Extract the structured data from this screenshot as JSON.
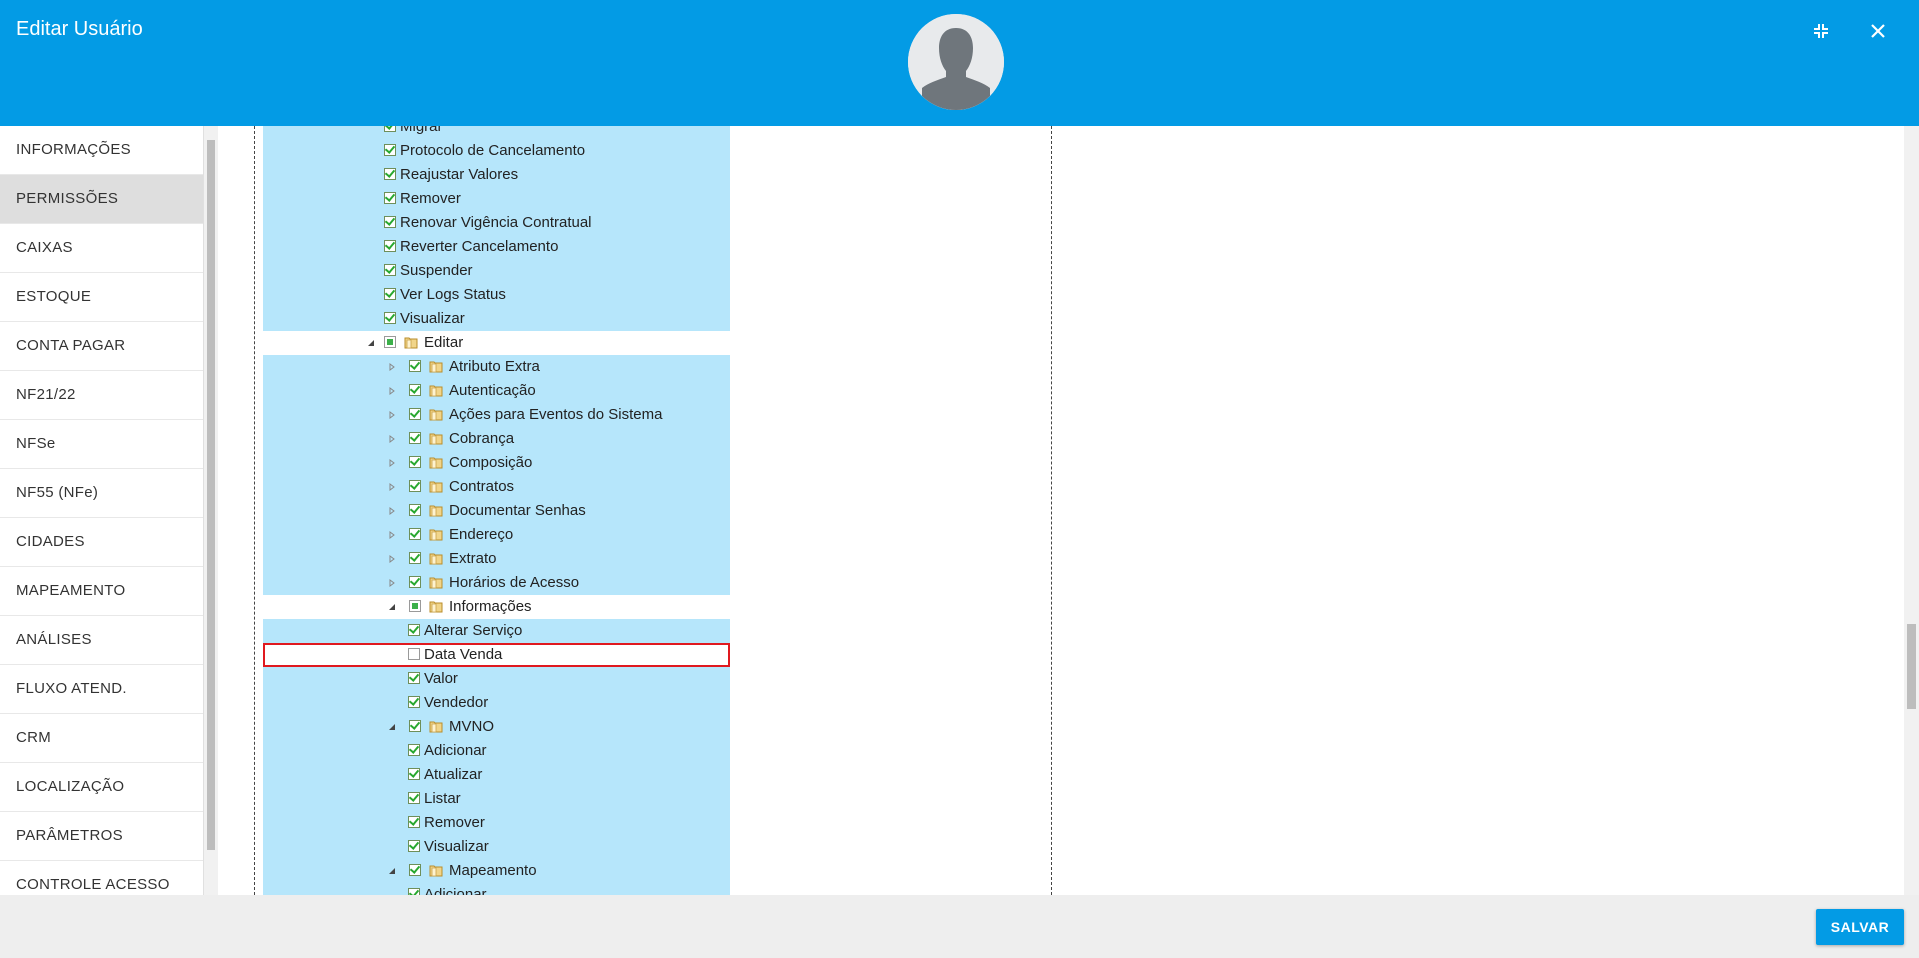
{
  "header": {
    "title": "Editar Usuário"
  },
  "sidebar": {
    "items": [
      {
        "label": "INFORMAÇÕES",
        "active": false
      },
      {
        "label": "PERMISSÕES",
        "active": true
      },
      {
        "label": "CAIXAS",
        "active": false
      },
      {
        "label": "ESTOQUE",
        "active": false
      },
      {
        "label": "CONTA PAGAR",
        "active": false
      },
      {
        "label": "NF21/22",
        "active": false
      },
      {
        "label": "NFSe",
        "active": false
      },
      {
        "label": "NF55 (NFe)",
        "active": false
      },
      {
        "label": "CIDADES",
        "active": false
      },
      {
        "label": "MAPEAMENTO",
        "active": false
      },
      {
        "label": "ANÁLISES",
        "active": false
      },
      {
        "label": "FLUXO ATEND.",
        "active": false
      },
      {
        "label": "CRM",
        "active": false
      },
      {
        "label": "LOCALIZAÇÃO",
        "active": false
      },
      {
        "label": "PARÂMETROS",
        "active": false
      },
      {
        "label": "CONTROLE ACESSO",
        "active": false
      }
    ]
  },
  "tree": {
    "rows": [
      {
        "label": "Migrar",
        "level": 0,
        "state": "checked",
        "folder": false,
        "expander": "none",
        "selected": true
      },
      {
        "label": "Protocolo de Cancelamento",
        "level": 0,
        "state": "checked",
        "folder": false,
        "expander": "none",
        "selected": true
      },
      {
        "label": "Reajustar Valores",
        "level": 0,
        "state": "checked",
        "folder": false,
        "expander": "none",
        "selected": true
      },
      {
        "label": "Remover",
        "level": 0,
        "state": "checked",
        "folder": false,
        "expander": "none",
        "selected": true
      },
      {
        "label": "Renovar Vigência Contratual",
        "level": 0,
        "state": "checked",
        "folder": false,
        "expander": "none",
        "selected": true
      },
      {
        "label": "Reverter Cancelamento",
        "level": 0,
        "state": "checked",
        "folder": false,
        "expander": "none",
        "selected": true
      },
      {
        "label": "Suspender",
        "level": 0,
        "state": "checked",
        "folder": false,
        "expander": "none",
        "selected": true
      },
      {
        "label": "Ver Logs Status",
        "level": 0,
        "state": "checked",
        "folder": false,
        "expander": "none",
        "selected": true
      },
      {
        "label": "Visualizar",
        "level": 0,
        "state": "checked",
        "folder": false,
        "expander": "none",
        "selected": true
      },
      {
        "label": "Editar",
        "level": 0,
        "state": "partial",
        "folder": true,
        "expander": "expanded",
        "selected": false
      },
      {
        "label": "Atributo Extra",
        "level": 1,
        "state": "checked",
        "folder": true,
        "expander": "collapsed",
        "selected": true
      },
      {
        "label": "Autenticação",
        "level": 1,
        "state": "checked",
        "folder": true,
        "expander": "collapsed",
        "selected": true
      },
      {
        "label": "Ações para Eventos do Sistema",
        "level": 1,
        "state": "checked",
        "folder": true,
        "expander": "collapsed",
        "selected": true
      },
      {
        "label": "Cobrança",
        "level": 1,
        "state": "checked",
        "folder": true,
        "expander": "collapsed",
        "selected": true
      },
      {
        "label": "Composição",
        "level": 1,
        "state": "checked",
        "folder": true,
        "expander": "collapsed",
        "selected": true
      },
      {
        "label": "Contratos",
        "level": 1,
        "state": "checked",
        "folder": true,
        "expander": "collapsed",
        "selected": true
      },
      {
        "label": "Documentar Senhas",
        "level": 1,
        "state": "checked",
        "folder": true,
        "expander": "collapsed",
        "selected": true
      },
      {
        "label": "Endereço",
        "level": 1,
        "state": "checked",
        "folder": true,
        "expander": "collapsed",
        "selected": true
      },
      {
        "label": "Extrato",
        "level": 1,
        "state": "checked",
        "folder": true,
        "expander": "collapsed",
        "selected": true
      },
      {
        "label": "Horários de Acesso",
        "level": 1,
        "state": "checked",
        "folder": true,
        "expander": "collapsed",
        "selected": true
      },
      {
        "label": "Informações",
        "level": 1,
        "state": "partial",
        "folder": true,
        "expander": "expanded",
        "selected": false
      },
      {
        "label": "Alterar Serviço",
        "level": 2,
        "state": "checked",
        "folder": false,
        "expander": "none",
        "selected": true
      },
      {
        "label": "Data Venda",
        "level": 2,
        "state": "unchecked",
        "folder": false,
        "expander": "none",
        "selected": false,
        "highlight": true
      },
      {
        "label": "Valor",
        "level": 2,
        "state": "checked",
        "folder": false,
        "expander": "none",
        "selected": true
      },
      {
        "label": "Vendedor",
        "level": 2,
        "state": "checked",
        "folder": false,
        "expander": "none",
        "selected": true
      },
      {
        "label": "MVNO",
        "level": 1,
        "state": "checked",
        "folder": true,
        "expander": "expanded",
        "selected": true
      },
      {
        "label": "Adicionar",
        "level": 2,
        "state": "checked",
        "folder": false,
        "expander": "none",
        "selected": true
      },
      {
        "label": "Atualizar",
        "level": 2,
        "state": "checked",
        "folder": false,
        "expander": "none",
        "selected": true
      },
      {
        "label": "Listar",
        "level": 2,
        "state": "checked",
        "folder": false,
        "expander": "none",
        "selected": true
      },
      {
        "label": "Remover",
        "level": 2,
        "state": "checked",
        "folder": false,
        "expander": "none",
        "selected": true
      },
      {
        "label": "Visualizar",
        "level": 2,
        "state": "checked",
        "folder": false,
        "expander": "none",
        "selected": true
      },
      {
        "label": "Mapeamento",
        "level": 1,
        "state": "checked",
        "folder": true,
        "expander": "expanded",
        "selected": true
      },
      {
        "label": "Adicionar",
        "level": 2,
        "state": "checked",
        "folder": false,
        "expander": "none",
        "selected": true
      }
    ]
  },
  "footer": {
    "save_label": "SALVAR"
  },
  "colors": {
    "accent": "#039be5",
    "selection": "#b6e6fb",
    "highlight_border": "#e0191f"
  },
  "icons": {
    "minimize": "collapse-arrows-icon",
    "close": "close-icon",
    "avatar": "user-silhouette-icon"
  }
}
